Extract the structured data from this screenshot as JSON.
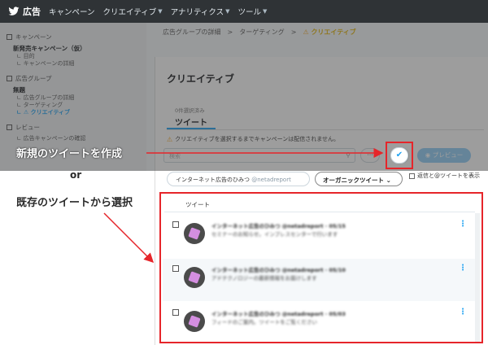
{
  "topbar": {
    "brand": "広告",
    "nav": [
      {
        "label": "キャンペーン",
        "has_menu": false
      },
      {
        "label": "クリエイティブ",
        "has_menu": true
      },
      {
        "label": "アナリティクス",
        "has_menu": true
      },
      {
        "label": "ツール",
        "has_menu": true
      }
    ]
  },
  "sidebar": {
    "campaign_section": "キャンペーン",
    "campaign_name": "新発売キャンペーン（仮）",
    "campaign_sub": [
      "目的",
      "キャンペーンの詳細"
    ],
    "adgroup_section": "広告グループ",
    "adgroup_name": "無題",
    "adgroup_sub": [
      "広告グループの詳細",
      "ターゲティング"
    ],
    "adgroup_active": "クリエイティブ",
    "review_section": "レビュー",
    "review_sub": [
      "広告キャンペーンの確認"
    ]
  },
  "breadcrumb": {
    "step1": "広告グループの詳細",
    "sep": ">",
    "step2": "ターゲティング",
    "step3": "クリエイティブ"
  },
  "panel": {
    "title": "クリエイティブ",
    "tab_small": "0件選択済み",
    "tab_label": "ツイート",
    "warning": "クリエイティブを選択するまでキャンペーンは配信されません。",
    "search_placeholder": "検索",
    "preview_label": "プレビュー",
    "account_chip": "インターネット広告のひみつ",
    "account_handle": "@netadreport",
    "type_chip": "オーガニックツイート",
    "replies_label": "返信と@ツイートを表示"
  },
  "list": {
    "header": "ツイート",
    "rows": [
      {
        "name": "インターネット広告のひみつ @netadreport · 05/15",
        "text": "セミナーのお知らせ。インプレスセンターで行います"
      },
      {
        "name": "インターネット広告のひみつ @netadreport · 05/10",
        "text": "アドテクノロジーの最新情報をお届けします"
      },
      {
        "name": "インターネット広告のひみつ @netadreport · 05/03",
        "text": "フィードのご案内。ツイートをご覧ください"
      }
    ]
  },
  "annotations": {
    "new": "新規のツイートを作成",
    "or": "or",
    "pick": "既存のツイートから選択"
  },
  "colors": {
    "accent": "#1da1f2",
    "highlight": "#e6252a",
    "topbar": "#2f3336",
    "warning": "#f5a623"
  }
}
